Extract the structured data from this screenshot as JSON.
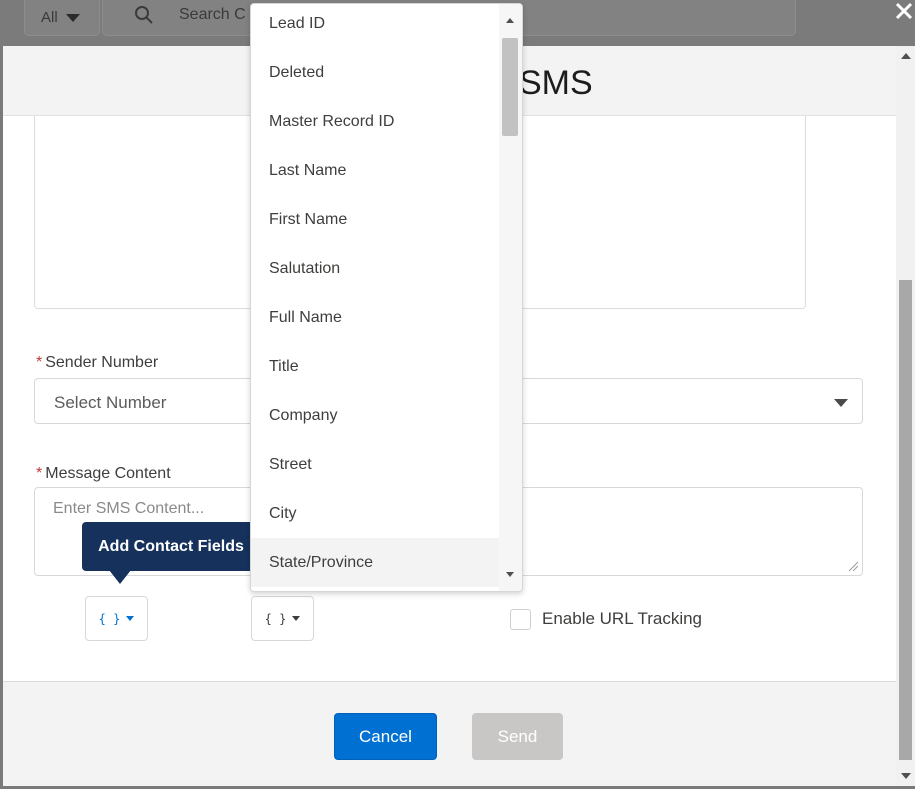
{
  "top_bar": {
    "scope_label": "All",
    "search_placeholder": "Search C"
  },
  "modal": {
    "title": "SMS",
    "sender_number": {
      "label": "Sender Number",
      "value": "Select Number"
    },
    "message_content": {
      "label": "Message Content",
      "placeholder": "Enter SMS Content..."
    },
    "tooltip": "Add Contact Fields",
    "merge_field_button_label": "{ }",
    "enable_url_tracking_label": "Enable URL Tracking",
    "footer": {
      "cancel_label": "Cancel",
      "send_label": "Send"
    }
  },
  "field_dropdown": {
    "items": [
      "Lead ID",
      "Deleted",
      "Master Record ID",
      "Last Name",
      "First Name",
      "Salutation",
      "Full Name",
      "Title",
      "Company",
      "Street",
      "City",
      "State/Province"
    ],
    "highlighted_item": "State/Province"
  },
  "colors": {
    "brand_blue": "#0070d2",
    "tooltip_navy": "#16325c",
    "required_red": "#c23934",
    "disabled_grey": "#c9c7c5"
  }
}
